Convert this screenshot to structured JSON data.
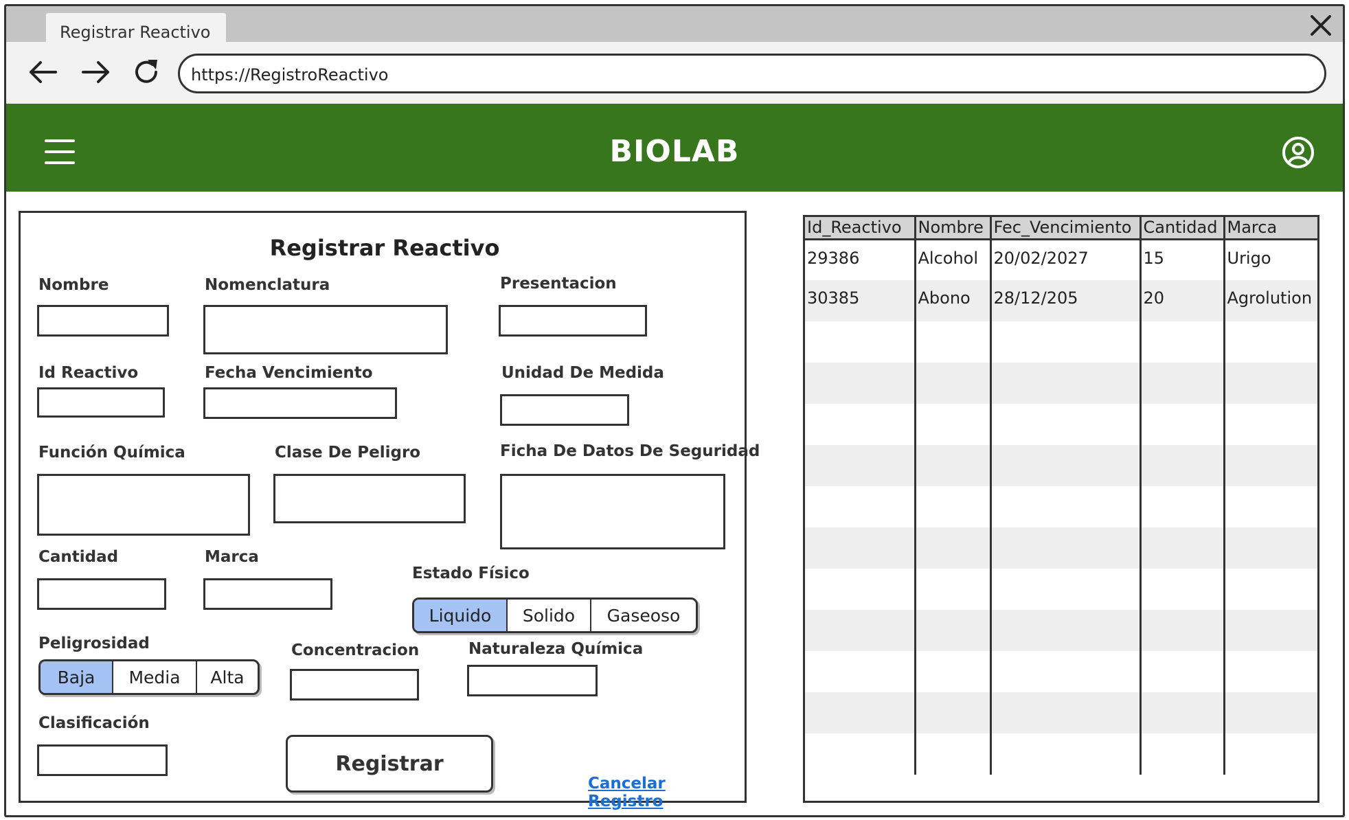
{
  "browser": {
    "tab_title": "Registrar Reactivo",
    "url": "https://RegistroReactivo"
  },
  "header": {
    "brand": "BIOLAB"
  },
  "form": {
    "title": "Registrar Reactivo",
    "labels": {
      "nombre": "Nombre",
      "nomenclatura": "Nomenclatura",
      "presentacion": "Presentacion",
      "id_reactivo": "Id Reactivo",
      "fecha_vencimiento": "Fecha Vencimiento",
      "unidad_medida": "Unidad De Medida",
      "funcion_quimica": "Función Química",
      "clase_peligro": "Clase De Peligro",
      "ficha_seguridad": "Ficha De Datos De Seguridad",
      "cantidad": "Cantidad",
      "marca": "Marca",
      "estado_fisico": "Estado Físico",
      "peligrosidad": "Peligrosidad",
      "concentracion": "Concentracion",
      "naturaleza_quimica": "Naturaleza Química",
      "clasificacion": "Clasificación"
    },
    "estado_fisico_options": [
      "Liquido",
      "Solido",
      "Gaseoso"
    ],
    "estado_fisico_selected": "Liquido",
    "peligrosidad_options": [
      "Baja",
      "Media",
      "Alta"
    ],
    "peligrosidad_selected": "Baja",
    "submit_label": "Registrar",
    "cancel_label": "Cancelar Registro"
  },
  "table": {
    "columns": [
      "Id_Reactivo",
      "Nombre",
      "Fec_Vencimiento",
      "Cantidad",
      "Marca"
    ],
    "rows": [
      [
        "29386",
        "Alcohol",
        "20/02/2027",
        "15",
        "Urigo"
      ],
      [
        "30385",
        "Abono",
        "28/12/205",
        "20",
        "Agrolution"
      ],
      [
        "",
        "",
        "",
        "",
        ""
      ],
      [
        "",
        "",
        "",
        "",
        ""
      ],
      [
        "",
        "",
        "",
        "",
        ""
      ],
      [
        "",
        "",
        "",
        "",
        ""
      ],
      [
        "",
        "",
        "",
        "",
        ""
      ],
      [
        "",
        "",
        "",
        "",
        ""
      ],
      [
        "",
        "",
        "",
        "",
        ""
      ],
      [
        "",
        "",
        "",
        "",
        ""
      ],
      [
        "",
        "",
        "",
        "",
        ""
      ],
      [
        "",
        "",
        "",
        "",
        ""
      ],
      [
        "",
        "",
        "",
        "",
        ""
      ]
    ]
  },
  "colors": {
    "header_green": "#38761d",
    "selected_blue": "#a4c2f4",
    "link_blue": "#1a6fd6"
  },
  "icons": {
    "back": "arrow-left-icon",
    "forward": "arrow-right-icon",
    "reload": "reload-icon",
    "close": "close-icon",
    "menu": "hamburger-menu-icon",
    "user": "user-account-icon"
  }
}
